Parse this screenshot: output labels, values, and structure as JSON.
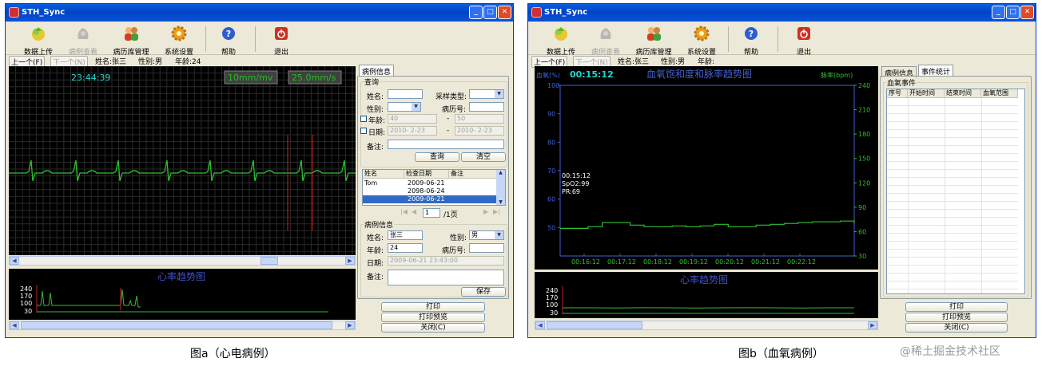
{
  "window_a": {
    "title": "STH_Sync",
    "toolbar": [
      {
        "label": "数据上传",
        "icon": "upload-icon",
        "enabled": true
      },
      {
        "label": "病例查看",
        "icon": "case-view-icon",
        "enabled": false
      },
      {
        "label": "病历库管理",
        "icon": "patients-icon",
        "enabled": true
      },
      {
        "label": "系统设置",
        "icon": "gear-icon",
        "enabled": true
      },
      {
        "label": "帮助",
        "icon": "help-icon",
        "enabled": true
      },
      {
        "label": "退出",
        "icon": "exit-icon",
        "enabled": true
      }
    ],
    "info": {
      "prev": "上一个(F)",
      "next": "下一个(N)",
      "name": "姓名:张三",
      "gender": "性别:男",
      "age": "年龄:24"
    },
    "ecg": {
      "time": "23:44:39",
      "gain": "10mm/mv",
      "speed": "25.0mm/s"
    },
    "trend": {
      "title": "心率趋势图",
      "ticks": [
        "240",
        "170",
        "100",
        "30"
      ]
    },
    "tabs": [
      "病例信息"
    ],
    "query": {
      "group_title": "查询",
      "name_label": "姓名:",
      "name_value": "",
      "type_label": "采样类型:",
      "type_value": "",
      "gender_label": "性别:",
      "gender_value": "",
      "record_label": "病历号:",
      "record_value": "",
      "age_label": "年龄:",
      "age_from": "40",
      "age_to": "50",
      "range_sep": "-",
      "date_label": "日期:",
      "date_from": "2010- 2-23",
      "date_to": "2010- 2-23",
      "note_label": "备注:",
      "note_value": "",
      "search_button": "查询",
      "clear_button": "清空"
    },
    "records": {
      "columns": [
        "姓名",
        "检查日期",
        "备注"
      ],
      "rows": [
        {
          "name": "Tom",
          "date": "2009-06-21",
          "note": ""
        },
        {
          "name": "",
          "date": "2098-06-24",
          "note": ""
        },
        {
          "name": "",
          "date": "2009-06-21",
          "note": ""
        }
      ],
      "page_value": "1",
      "page_total": "/1页"
    },
    "patient": {
      "group_title": "病例信息",
      "name_label": "姓名:",
      "name_value": "张三",
      "gender_label": "性别:",
      "gender_value": "男",
      "age_label": "年龄:",
      "age_value": "24",
      "record_label": "病历号:",
      "record_value": "",
      "date_label": "日期:",
      "date_value": "2009-06-21 23:43:00",
      "note_label": "备注:",
      "note_value": "",
      "save_button": "保存"
    },
    "actions": {
      "print": "打印",
      "preview": "打印预览",
      "close": "关闭(C)"
    }
  },
  "window_b": {
    "title": "STH_Sync",
    "toolbar": [
      {
        "label": "数据上传",
        "icon": "upload-icon",
        "enabled": true
      },
      {
        "label": "病例查看",
        "icon": "case-view-icon",
        "enabled": false
      },
      {
        "label": "病历库管理",
        "icon": "patients-icon",
        "enabled": true
      },
      {
        "label": "系统设置",
        "icon": "gear-icon",
        "enabled": true
      },
      {
        "label": "帮助",
        "icon": "help-icon",
        "enabled": true
      },
      {
        "label": "退出",
        "icon": "exit-icon",
        "enabled": true
      }
    ],
    "info": {
      "prev": "上一个(F)",
      "next": "下一个(N)",
      "name": "姓名:张三",
      "gender": "性别:男",
      "age": "年龄:"
    },
    "spo2": {
      "time": "00:15:12",
      "title": "血氧饱和度和脉率趋势图",
      "left_label": "血氧(%)",
      "right_label": "脉率(bpm)",
      "cursor_time": "00:15:12",
      "cursor_spo2": "SpO2:99",
      "cursor_pr": "PR:69"
    },
    "trend": {
      "title": "心率趋势图",
      "ticks": [
        "240",
        "170",
        "100",
        "30"
      ]
    },
    "tabs": [
      "病例信息",
      "事件统计"
    ],
    "events": {
      "group_title": "血氧事件",
      "columns": [
        "序号",
        "开始时间",
        "结束时间",
        "血氧范围"
      ]
    },
    "actions": {
      "print": "打印",
      "preview": "打印预览",
      "close": "关闭(C)"
    }
  },
  "captions": {
    "a": "图a（心电病例）",
    "b": "图b（血氧病例）",
    "watermark": "@稀土掘金技术社区"
  },
  "chart_data": [
    {
      "type": "line",
      "title": "血氧饱和度和脉率趋势图",
      "x": [
        "00:16:12",
        "00:17:12",
        "00:18:12",
        "00:19:12",
        "00:20:12",
        "00:21:12",
        "00:22:12"
      ],
      "ylabel": "血氧(%)",
      "ylim": [
        40,
        100
      ],
      "yticks": [
        50,
        60,
        70,
        80,
        90,
        100
      ],
      "y2label": "脉率(bpm)",
      "y2lim": [
        30,
        240
      ],
      "y2ticks": [
        30,
        60,
        90,
        120,
        150,
        180,
        210,
        240
      ],
      "series": [
        {
          "values": [
            64,
            64,
            66,
            71,
            71,
            68,
            66,
            66,
            67,
            66,
            67,
            69,
            66,
            66,
            68,
            69,
            70,
            71,
            72,
            72,
            73,
            70
          ]
        }
      ]
    },
    {
      "type": "line",
      "title": "心率趋势图",
      "yticks": [
        240,
        170,
        100,
        30
      ],
      "ylim": [
        30,
        240
      ],
      "series": [
        {
          "values": [
            73,
            73,
            72,
            74,
            73,
            72,
            73,
            74,
            73,
            72,
            73,
            73
          ]
        }
      ]
    }
  ]
}
